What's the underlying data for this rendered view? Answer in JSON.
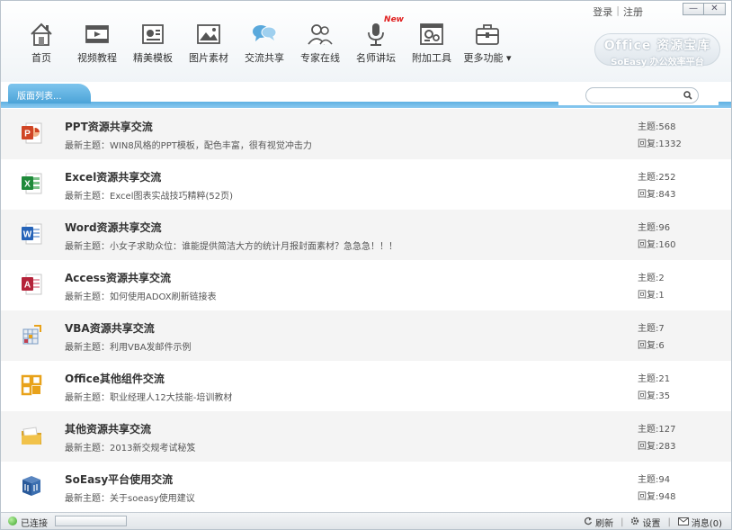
{
  "header": {
    "login": "登录",
    "register": "注册",
    "minimize": "—",
    "close": "✕",
    "brand_line1": "Office 资源宝库",
    "brand_line2": "SoEasy 办公效率平台"
  },
  "nav": [
    {
      "label": "首页",
      "icon": "home-icon"
    },
    {
      "label": "视频教程",
      "icon": "video-icon"
    },
    {
      "label": "精美模板",
      "icon": "template-icon"
    },
    {
      "label": "图片素材",
      "icon": "image-icon"
    },
    {
      "label": "交流共享",
      "icon": "chat-icon"
    },
    {
      "label": "专家在线",
      "icon": "experts-icon"
    },
    {
      "label": "名师讲坛",
      "icon": "microphone-icon",
      "badge": "New"
    },
    {
      "label": "附加工具",
      "icon": "tools-icon"
    },
    {
      "label": "更多功能 ▾",
      "icon": "toolbox-icon"
    }
  ],
  "tab": {
    "label": "版面列表..."
  },
  "search": {
    "placeholder": ""
  },
  "forums": [
    {
      "title": "PPT资源共享交流",
      "latest": "最新主题：WIN8风格的PPT模板，配色丰富，很有视觉冲击力",
      "topics": "主题:568",
      "replies": "回复:1332",
      "icon": "powerpoint-icon",
      "color": "#d04525"
    },
    {
      "title": "Excel资源共享交流",
      "latest": "最新主题：Excel图表实战技巧精粹(52页)",
      "topics": "主题:252",
      "replies": "回复:843",
      "icon": "excel-icon",
      "color": "#1f8a3a"
    },
    {
      "title": "Word资源共享交流",
      "latest": "最新主题：小女子求助众位：谁能提供简洁大方的统计月报封面素材？急急急！！！",
      "topics": "主题:96",
      "replies": "回复:160",
      "icon": "word-icon",
      "color": "#2563b8"
    },
    {
      "title": "Access资源共享交流",
      "latest": "最新主题：如何使用ADOX刷新链接表",
      "topics": "主题:2",
      "replies": "回复:1",
      "icon": "access-icon",
      "color": "#b5233a"
    },
    {
      "title": "VBA资源共享交流",
      "latest": "最新主题：利用VBA发邮件示例",
      "topics": "主题:7",
      "replies": "回复:6",
      "icon": "vba-icon",
      "color": "#7a9bc4"
    },
    {
      "title": "Office其他组件交流",
      "latest": "最新主题：职业经理人12大技能-培训教材",
      "topics": "主题:21",
      "replies": "回复:35",
      "icon": "office-icon",
      "color": "#e8a21a"
    },
    {
      "title": "其他资源共享交流",
      "latest": "最新主题：2013新交规考试秘笈",
      "topics": "主题:127",
      "replies": "回复:283",
      "icon": "folder-icon",
      "color": "#e8b83a"
    },
    {
      "title": "SoEasy平台使用交流",
      "latest": "最新主题：关于soeasy使用建议",
      "topics": "主题:94",
      "replies": "回复:948",
      "icon": "soeasy-icon",
      "color": "#2a5a9a"
    }
  ],
  "status": {
    "connected": "已连接",
    "refresh": "刷新",
    "settings": "设置",
    "messages": "消息(0)"
  }
}
